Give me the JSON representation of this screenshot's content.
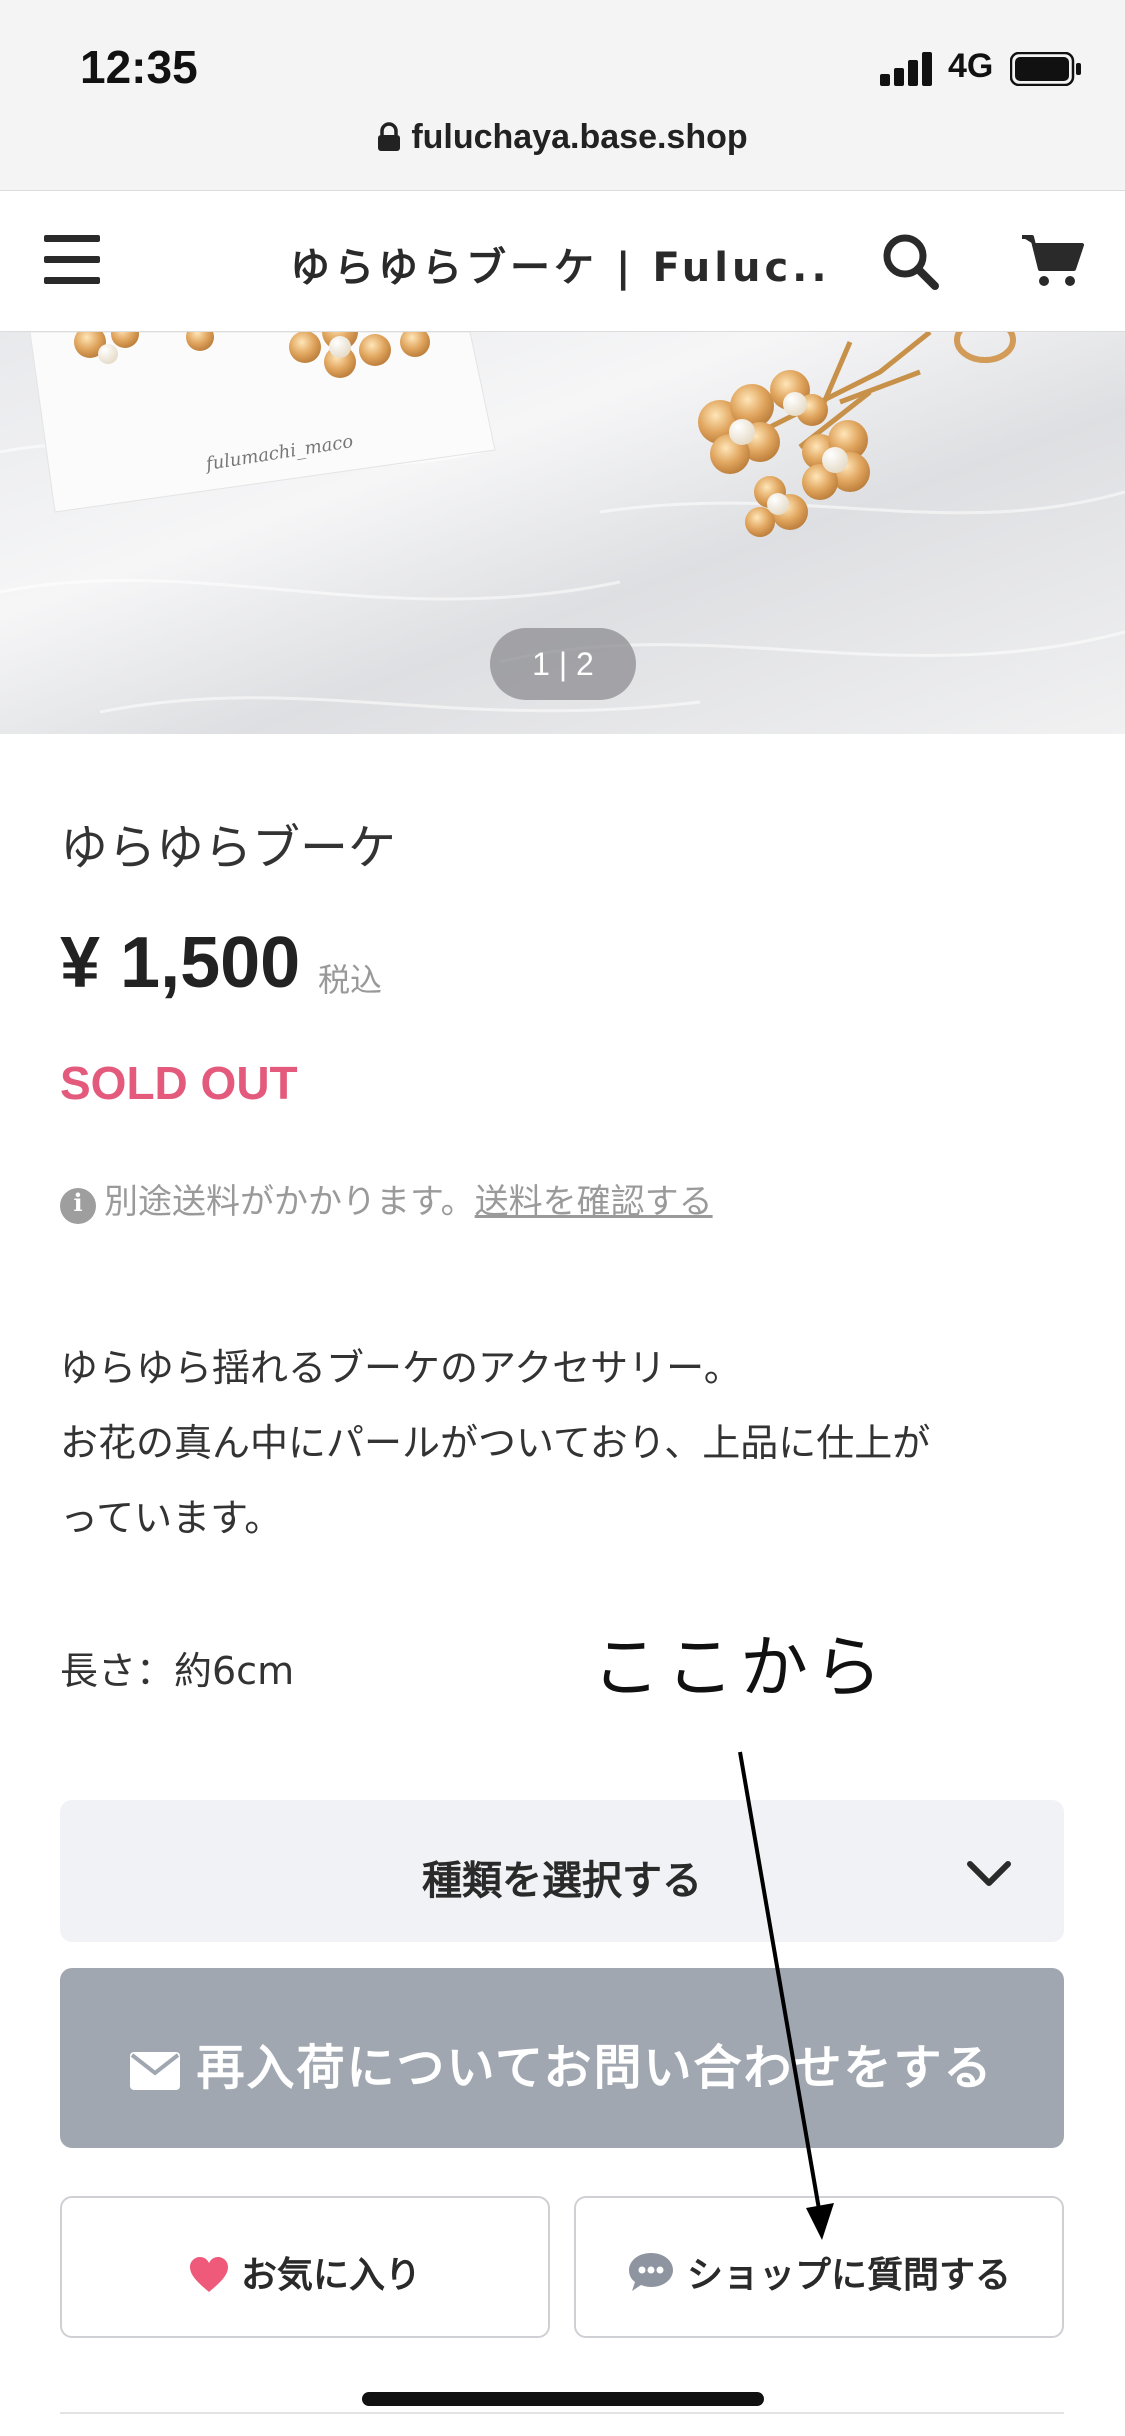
{
  "status_bar": {
    "time": "12:35",
    "network": "4G"
  },
  "browser": {
    "url": "fuluchaya.base.shop"
  },
  "header": {
    "site_title": "ゆらゆらブーケ | Fuluc..."
  },
  "product": {
    "image_card_text": "fulumachi_maco",
    "image_counter": "1 | 2",
    "name": "ゆらゆらブーケ",
    "price": "¥ 1,500",
    "tax_label": "税込",
    "status": "SOLD OUT",
    "shipping_note": "別途送料がかかります。",
    "shipping_link": "送料を確認する",
    "description": [
      "ゆらゆら揺れるブーケのアクセサリー。",
      "お花の真ん中にパールがついており、上品に仕上が",
      "っています。"
    ],
    "length": "長さ：約6cm"
  },
  "annotation": {
    "text": "ここから"
  },
  "controls": {
    "variant_select": "種類を選択する",
    "restock_button": "再入荷についてお問い合わせをする",
    "favorite_button": "お気に入り",
    "ask_shop_button": "ショップに質問する"
  },
  "colors": {
    "sold_out": "#e45a7c",
    "restock_bg": "#a1a7b1",
    "heart": "#f05a7a",
    "select_bg": "#f1f2f5"
  }
}
